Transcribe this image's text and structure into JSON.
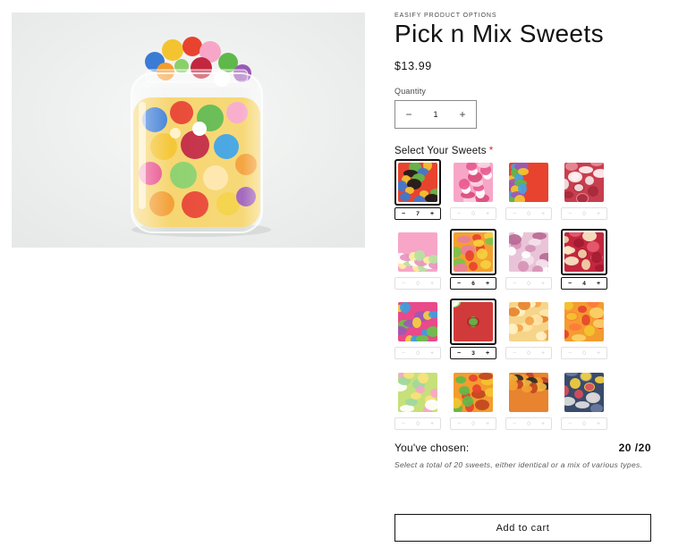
{
  "product": {
    "vendor": "EASIFY PRODUCT OPTIONS",
    "title": "Pick n Mix Sweets",
    "price": "$13.99",
    "image_alt": "Glass jar filled with assorted pick n mix sweets"
  },
  "quantity": {
    "label": "Quantity",
    "value": "1",
    "minus_icon": "minus-icon",
    "plus_icon": "plus-icon"
  },
  "select_sweets": {
    "label": "Select Your Sweets",
    "required_marker": "*",
    "items": [
      {
        "count": "7",
        "selected": true,
        "colors": [
          "#e8432f",
          "#f4c430",
          "#3a7bd5",
          "#5fb84a",
          "#1a1a1a"
        ]
      },
      {
        "count": "0",
        "selected": false,
        "colors": [
          "#f7a6c8",
          "#ffffff",
          "#e85a8f",
          "#f9d4e2",
          "#d94c7c"
        ]
      },
      {
        "count": "0",
        "selected": false,
        "colors": [
          "#e8432f",
          "#4a9fe0",
          "#f4c430",
          "#5fb84a",
          "#9b59b6"
        ]
      },
      {
        "count": "0",
        "selected": false,
        "colors": [
          "#c73e4f",
          "#f4e4e4",
          "#a8283b",
          "#e88a96",
          "#fff2f2"
        ]
      },
      {
        "count": "0",
        "selected": false,
        "colors": [
          "#f7a6c8",
          "#fff0a0",
          "#b6e3a1",
          "#ffffff",
          "#e894c0"
        ]
      },
      {
        "count": "6",
        "selected": true,
        "colors": [
          "#f4a030",
          "#e8432f",
          "#f4d03f",
          "#7ac14e",
          "#e87f9b"
        ]
      },
      {
        "count": "0",
        "selected": false,
        "colors": [
          "#e9c4d9",
          "#ffffff",
          "#d692b6",
          "#f3e1ec",
          "#b86a94"
        ]
      },
      {
        "count": "4",
        "selected": true,
        "colors": [
          "#c2273f",
          "#f4d4a8",
          "#a31a30",
          "#e85a6f",
          "#fbe7c4"
        ]
      },
      {
        "count": "0",
        "selected": false,
        "colors": [
          "#e84a8a",
          "#f4d03f",
          "#3aa0e0",
          "#6cc04a",
          "#9b59b6"
        ]
      },
      {
        "count": "3",
        "selected": true,
        "colors": [
          "#d13a3a",
          "#5fb84a",
          "#ffffff",
          "#b32828",
          "#8ad06a"
        ]
      },
      {
        "count": "0",
        "selected": false,
        "colors": [
          "#f6d58a",
          "#f3a54a",
          "#fff2c7",
          "#e8832f",
          "#ffe6a8"
        ]
      },
      {
        "count": "0",
        "selected": false,
        "colors": [
          "#f39c2f",
          "#e8432f",
          "#f4c430",
          "#ff7a3d",
          "#fbd36a"
        ]
      },
      {
        "count": "0",
        "selected": false,
        "colors": [
          "#c6e07a",
          "#f7a6c8",
          "#f9e27a",
          "#9fd8a0",
          "#ffffff"
        ]
      },
      {
        "count": "0",
        "selected": false,
        "colors": [
          "#f39c2f",
          "#e8432f",
          "#5fb84a",
          "#f4c430",
          "#c2451f"
        ]
      },
      {
        "count": "0",
        "selected": false,
        "colors": [
          "#e8832f",
          "#c2451f",
          "#f4a030",
          "#2a2a2a",
          "#f2b640"
        ]
      },
      {
        "count": "0",
        "selected": false,
        "colors": [
          "#3a4a6a",
          "#d94c5c",
          "#f4d03f",
          "#6a7aa0",
          "#e0e0e0"
        ]
      }
    ]
  },
  "chosen": {
    "label": "You've chosen:",
    "count": "20 /20"
  },
  "note": "Select a total of 20 sweets, either identical or a mix of various types.",
  "cart": {
    "label": "Add to cart"
  },
  "colors": {
    "text": "#121212",
    "required": "#e0253a",
    "border": "#8a8a8a"
  }
}
